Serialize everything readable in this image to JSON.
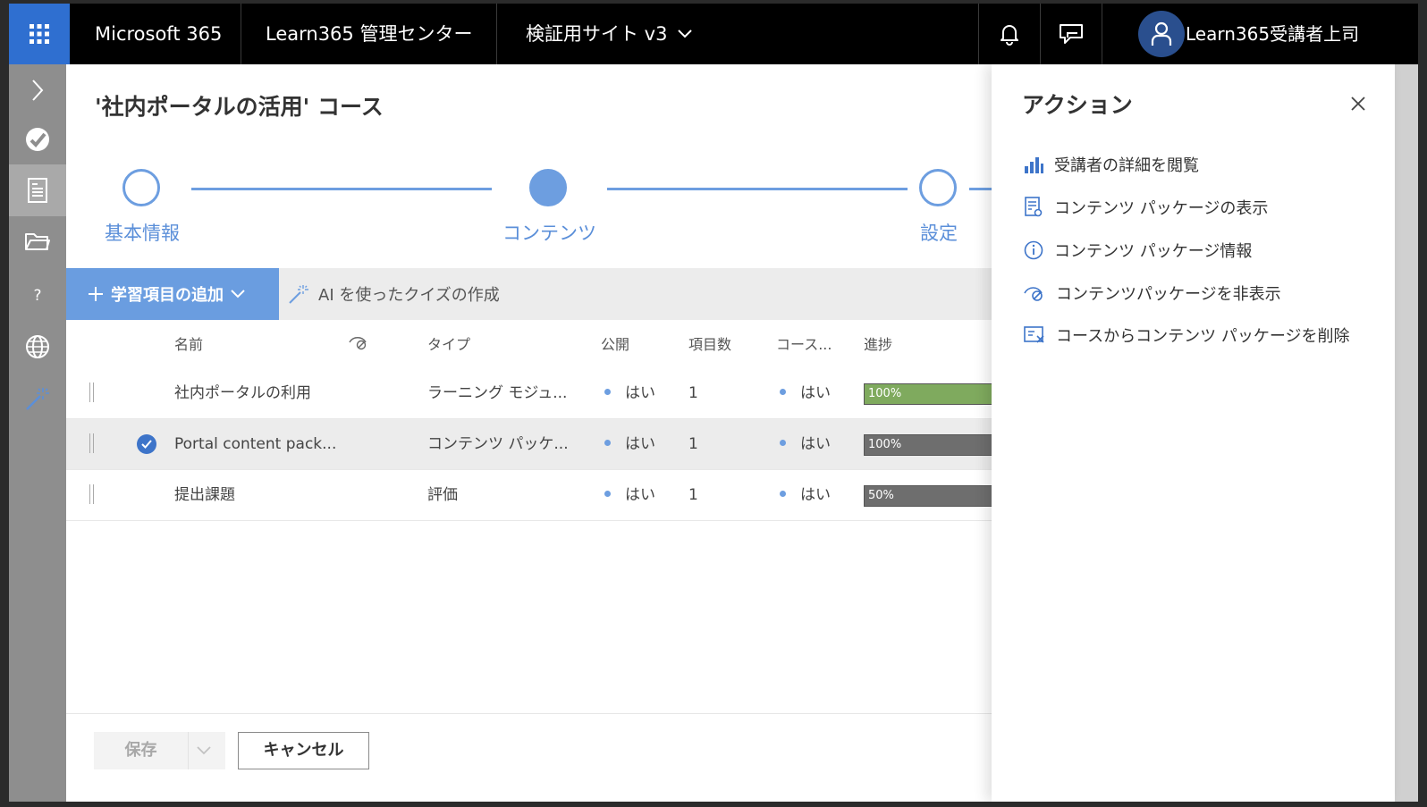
{
  "topbar": {
    "brand": "Microsoft 365",
    "admin_center": "Learn365 管理センター",
    "site": "検証用サイト v3",
    "user": "Learn365受講者上司",
    "colors": {
      "waffle": "#2f6fd0",
      "bar": "#000000",
      "avatar": "#2a4f8e"
    },
    "icons": [
      "waffle-icon",
      "chevron-down-icon",
      "bell-icon",
      "feedback-icon",
      "person-icon"
    ]
  },
  "rail": {
    "icons": [
      "chevron-right-icon",
      "learn365-logo-icon",
      "document-icon",
      "folder-icon",
      "question-icon",
      "globe-icon",
      "magic-wand-icon"
    ],
    "active_index": 2,
    "question_label": "?"
  },
  "page": {
    "title": "'社内ポータルの活用' コース"
  },
  "steps": [
    {
      "label": "基本情報",
      "state": "done"
    },
    {
      "label": "コンテンツ",
      "state": "current"
    },
    {
      "label": "設定",
      "state": "pending"
    }
  ],
  "commands": {
    "add_item": "学習項目の追加",
    "ai_quiz": "AI を使ったクイズの作成"
  },
  "table": {
    "headers": {
      "name": "名前",
      "type": "タイプ",
      "published": "公開",
      "item_count": "項目数",
      "course": "コース...",
      "progress": "進捗"
    },
    "rows": [
      {
        "name": "社内ポータルの利用",
        "type": "ラーニング モジュ...",
        "published": "はい",
        "item_count": "1",
        "course": "はい",
        "progress": 1.0,
        "progress_label": "100%",
        "progress_color": "#7faa5e",
        "selected": false
      },
      {
        "name": "Portal content pack...",
        "type": "コンテンツ パッケ...",
        "published": "はい",
        "item_count": "1",
        "course": "はい",
        "progress": 1.0,
        "progress_label": "100%",
        "progress_color": "#6e6e6e",
        "selected": true
      },
      {
        "name": "提出課題",
        "type": "評価",
        "published": "はい",
        "item_count": "1",
        "course": "はい",
        "progress": 0.5,
        "progress_label": "50%",
        "progress_color": "#6e6e6e",
        "selected": false
      }
    ]
  },
  "footer": {
    "save": "保存",
    "cancel": "キャンセル"
  },
  "panel": {
    "title": "アクション",
    "actions": [
      {
        "label": "受講者の詳細を閲覧",
        "icon": "bar-chart-icon"
      },
      {
        "label": "コンテンツ パッケージの表示",
        "icon": "view-document-icon"
      },
      {
        "label": "コンテンツ パッケージ情報",
        "icon": "info-icon"
      },
      {
        "label": "コンテンツパッケージを非表示",
        "icon": "hide-icon"
      },
      {
        "label": "コースからコンテンツ パッケージを削除",
        "icon": "remove-icon"
      }
    ]
  }
}
